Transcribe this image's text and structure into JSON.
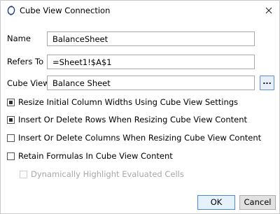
{
  "window": {
    "title": "Cube View Connection",
    "app_icon": "onestream-logo-icon",
    "close_icon": "close-icon"
  },
  "form": {
    "name_label": "Name",
    "name_value": "BalanceSheet",
    "refers_to_label": "Refers To",
    "refers_to_value": "=Sheet1!$A$1",
    "cube_view_label": "Cube View",
    "cube_view_value": "Balance Sheet",
    "browse_label": "..."
  },
  "options": [
    {
      "label": "Resize Initial Column Widths Using Cube View Settings",
      "checked": true,
      "enabled": true
    },
    {
      "label": "Insert Or Delete Rows When Resizing Cube View Content",
      "checked": true,
      "enabled": true
    },
    {
      "label": "Insert Or Delete Columns When Resizing Cube View Content",
      "checked": false,
      "enabled": true
    },
    {
      "label": "Retain Formulas In Cube View Content",
      "checked": false,
      "enabled": true
    },
    {
      "label": "Dynamically Highlight Evaluated Cells",
      "checked": false,
      "enabled": false
    }
  ],
  "buttons": {
    "ok": "OK",
    "cancel": "Cancel"
  },
  "colors": {
    "accent_border": "#4a8ad4",
    "accent_fill": "#e5f1fb",
    "disabled_text": "#a8a8a8"
  }
}
